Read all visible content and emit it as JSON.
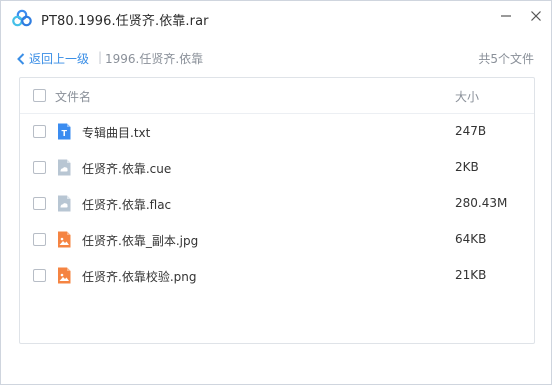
{
  "window": {
    "title": "PT80.1996.任贤齐.依靠.rar"
  },
  "toolbar": {
    "back_label": "返回上一级",
    "separator": "|",
    "breadcrumb": "1996.任贤齐.依靠",
    "file_count": "共5个文件"
  },
  "list": {
    "header": {
      "name": "文件名",
      "size": "大小"
    },
    "files": [
      {
        "name": "专辑曲目.txt",
        "size": "247B",
        "icon": "txt-file-icon",
        "color": "#3b8cf0"
      },
      {
        "name": "任贤齐.依靠.cue",
        "size": "2KB",
        "icon": "generic-file-icon",
        "color": "#b8c6d3"
      },
      {
        "name": "任贤齐.依靠.flac",
        "size": "280.43M",
        "icon": "generic-file-icon",
        "color": "#b8c6d3"
      },
      {
        "name": "任贤齐.依靠_副本.jpg",
        "size": "64KB",
        "icon": "image-file-icon",
        "color": "#f58442"
      },
      {
        "name": "任贤齐.依靠校验.png",
        "size": "21KB",
        "icon": "image-file-icon",
        "color": "#f58442"
      }
    ]
  },
  "colors": {
    "accent": "#3a8ee6",
    "muted_text": "#8a9099",
    "border": "#dfe3e8"
  }
}
